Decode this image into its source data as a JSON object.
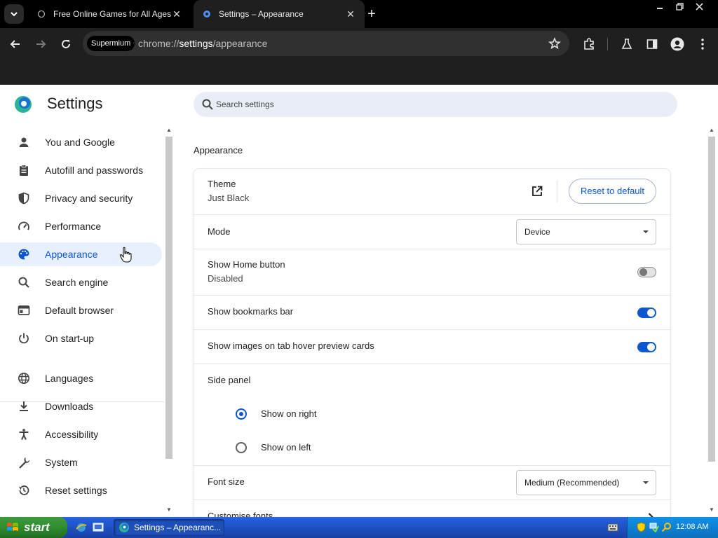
{
  "browser": {
    "tabs": [
      {
        "title": "Free Online Games for All Ages - St",
        "active": false
      },
      {
        "title": "Settings – Appearance",
        "active": true
      }
    ],
    "omnibox": {
      "site_chip": "Supermium",
      "url_scheme": "chrome://",
      "url_host": "settings",
      "url_path": "/appearance"
    }
  },
  "settings": {
    "title": "Settings",
    "search_placeholder": "Search settings",
    "nav_items": [
      {
        "label": "You and Google",
        "icon": "person-icon"
      },
      {
        "label": "Autofill and passwords",
        "icon": "clipboard-icon"
      },
      {
        "label": "Privacy and security",
        "icon": "shield-icon"
      },
      {
        "label": "Performance",
        "icon": "speedometer-icon"
      },
      {
        "label": "Appearance",
        "icon": "palette-icon",
        "selected": true
      },
      {
        "label": "Search engine",
        "icon": "search-icon"
      },
      {
        "label": "Default browser",
        "icon": "browser-window-icon"
      },
      {
        "label": "On start-up",
        "icon": "power-icon"
      },
      {
        "label": "Languages",
        "icon": "globe-icon"
      },
      {
        "label": "Downloads",
        "icon": "download-icon"
      },
      {
        "label": "Accessibility",
        "icon": "accessibility-icon"
      },
      {
        "label": "System",
        "icon": "wrench-icon"
      },
      {
        "label": "Reset settings",
        "icon": "history-icon"
      }
    ],
    "section_title": "Appearance",
    "theme": {
      "label": "Theme",
      "value": "Just Black",
      "reset_label": "Reset to default"
    },
    "mode": {
      "label": "Mode",
      "value": "Device"
    },
    "home_button": {
      "label": "Show Home button",
      "value": "Disabled",
      "enabled": false
    },
    "bookmarks_bar": {
      "label": "Show bookmarks bar",
      "enabled": true
    },
    "tab_hover": {
      "label": "Show images on tab hover preview cards",
      "enabled": true
    },
    "side_panel": {
      "label": "Side panel",
      "options": [
        {
          "label": "Show on right",
          "checked": true
        },
        {
          "label": "Show on left",
          "checked": false
        }
      ]
    },
    "font_size": {
      "label": "Font size",
      "value": "Medium (Recommended)"
    },
    "customise_fonts": {
      "label": "Customise fonts"
    }
  },
  "taskbar": {
    "start_label": "start",
    "task_label": "Settings – Appearanc...",
    "clock": "12:08 AM"
  },
  "colors": {
    "accent": "#0b57d0",
    "selected_nav_bg": "#e8f0fe",
    "chrome_dark": "#1f1f1f"
  }
}
